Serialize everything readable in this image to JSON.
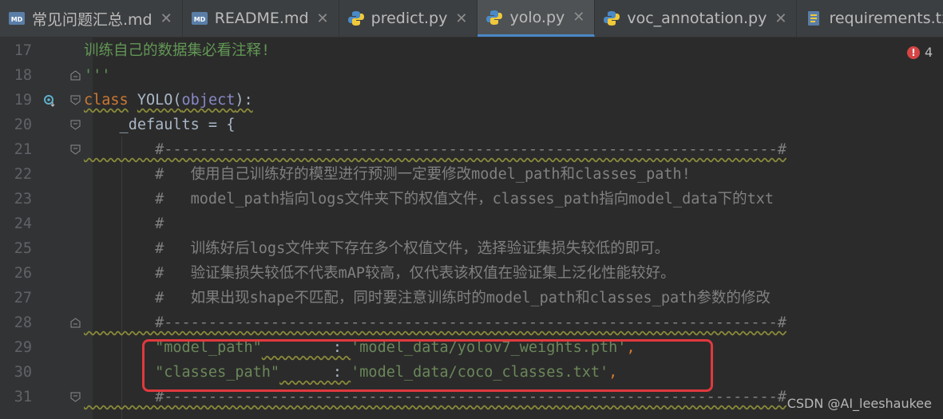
{
  "tabs": [
    {
      "label": "常见问题汇总.md",
      "icon": "markdown-icon",
      "active": false
    },
    {
      "label": "README.md",
      "icon": "markdown-icon",
      "active": false
    },
    {
      "label": "predict.py",
      "icon": "python-icon",
      "active": false
    },
    {
      "label": "yolo.py",
      "icon": "python-icon",
      "active": true
    },
    {
      "label": "voc_annotation.py",
      "icon": "python-icon",
      "active": false
    },
    {
      "label": "requirements.txt",
      "icon": "text-file-icon",
      "active": false
    }
  ],
  "problems": {
    "error_count": "4"
  },
  "lines": [
    {
      "no": "17",
      "text": "训练自己的数据集必看注释!"
    },
    {
      "no": "18",
      "text": "'''"
    },
    {
      "no": "19",
      "kw": "class",
      "name": "YOLO",
      "paren_open": "(",
      "base": "object",
      "rest": "):"
    },
    {
      "no": "20",
      "text": "    _defaults = {"
    },
    {
      "no": "21",
      "text": "        #---------------------------------------------------------------------#"
    },
    {
      "no": "22",
      "text": "        #   使用自己训练好的模型进行预测一定要修改model_path和classes_path!"
    },
    {
      "no": "23",
      "text": "        #   model_path指向logs文件夹下的权值文件，classes_path指向model_data下的txt"
    },
    {
      "no": "24",
      "text": "        #"
    },
    {
      "no": "25",
      "text": "        #   训练好后logs文件夹下存在多个权值文件，选择验证集损失较低的即可。"
    },
    {
      "no": "26",
      "text": "        #   验证集损失较低不代表mAP较高，仅代表该权值在验证集上泛化性能较好。"
    },
    {
      "no": "27",
      "text": "        #   如果出现shape不匹配，同时要注意训练时的model_path和classes_path参数的修改"
    },
    {
      "no": "28",
      "text": "        #---------------------------------------------------------------------#"
    },
    {
      "no": "29",
      "key": "\"model_path\"",
      "pad": "        : ",
      "value": "'model_data/yolov7_weights.pth'",
      "end": ","
    },
    {
      "no": "30",
      "key": "\"classes_path\"",
      "pad": "      : ",
      "value": "'model_data/coco_classes.txt'",
      "end": ","
    },
    {
      "no": "31",
      "text": "        #---------------------------------------------------------------------#"
    }
  ],
  "watermark": "CSDN @AI_leeshaukee"
}
